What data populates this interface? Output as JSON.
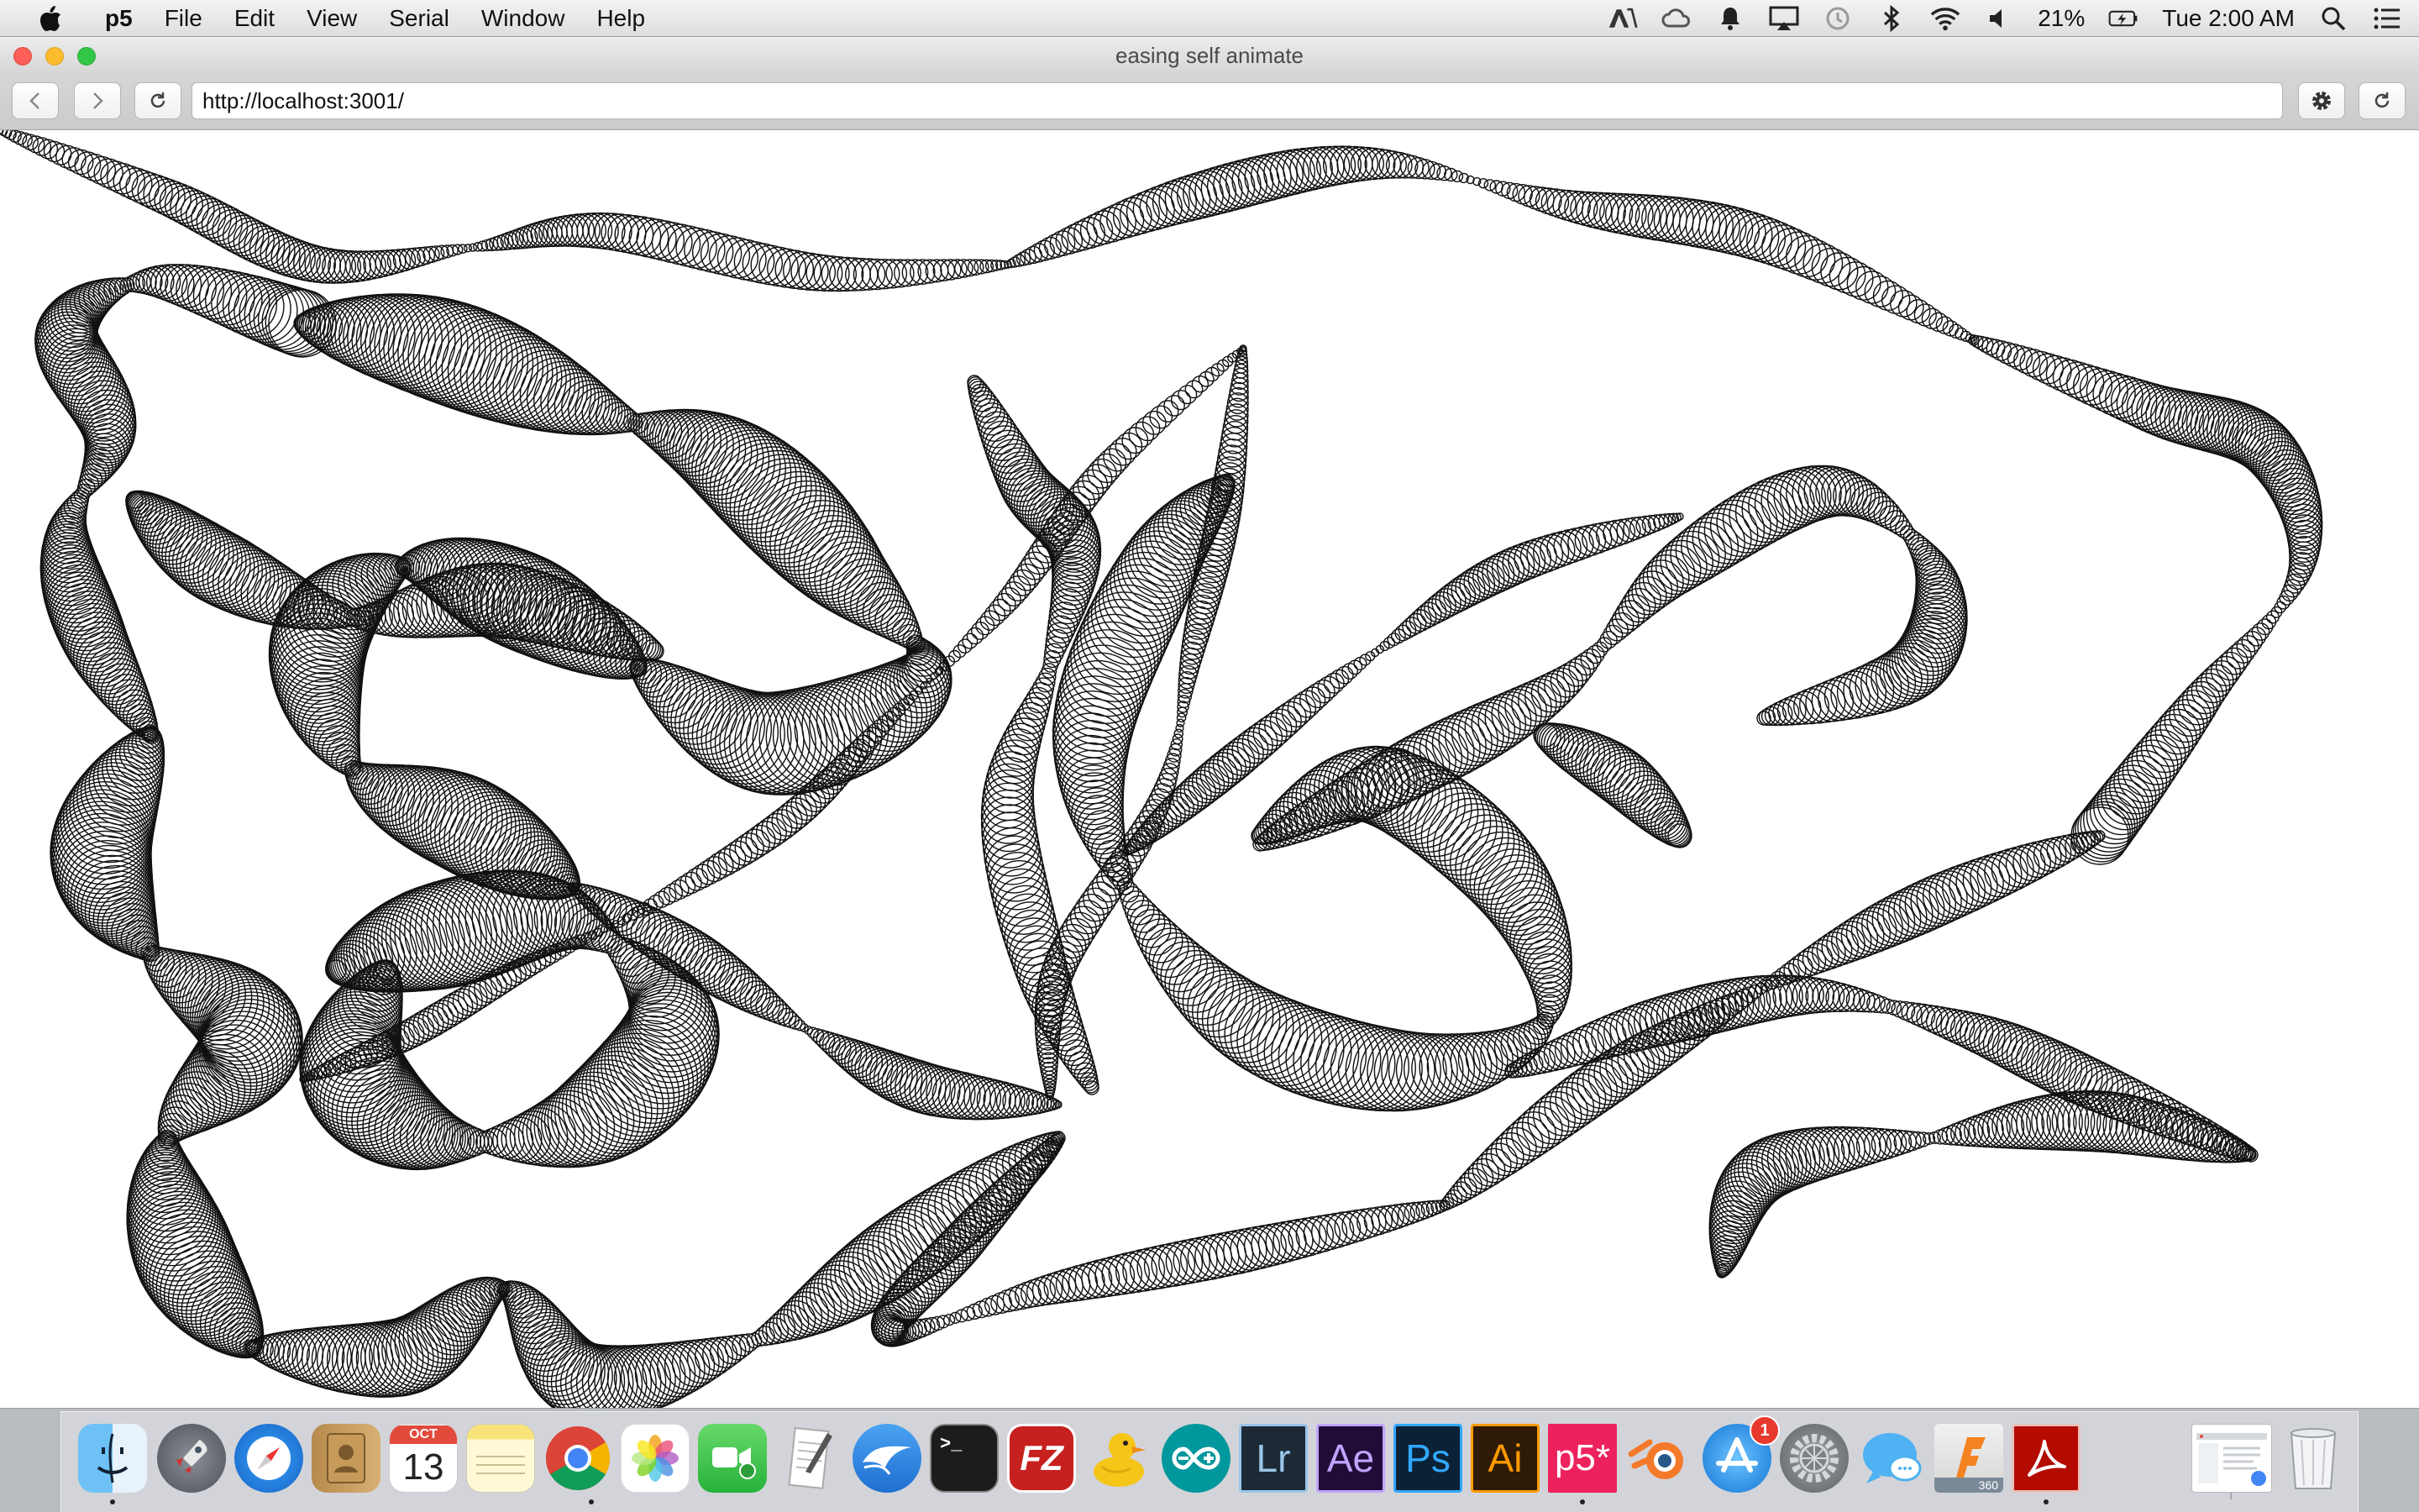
{
  "menubar": {
    "app_name": "p5",
    "items": [
      "File",
      "Edit",
      "View",
      "Serial",
      "Window",
      "Help"
    ],
    "status": {
      "battery_percent": "21%",
      "clock": "Tue 2:00 AM"
    }
  },
  "window": {
    "title": "easing self animate",
    "url": "http://localhost:3001/"
  },
  "dock": {
    "apps": [
      {
        "name": "Finder",
        "icon": "finder-icon",
        "running": true
      },
      {
        "name": "Launchpad",
        "icon": "launchpad-icon",
        "running": false
      },
      {
        "name": "Safari",
        "icon": "safari-icon",
        "running": false
      },
      {
        "name": "Contacts",
        "icon": "contacts-icon",
        "running": false
      },
      {
        "name": "Calendar",
        "icon": "calendar-icon",
        "running": false,
        "month": "OCT",
        "day": "13"
      },
      {
        "name": "Notes",
        "icon": "notes-icon",
        "running": false
      },
      {
        "name": "Chrome",
        "icon": "chrome-icon",
        "running": true
      },
      {
        "name": "Photos",
        "icon": "photos-icon",
        "running": false
      },
      {
        "name": "FaceTime",
        "icon": "facetime-icon",
        "running": false
      },
      {
        "name": "TextEdit",
        "icon": "textedit-icon",
        "running": false
      },
      {
        "name": "Mail",
        "icon": "mail-icon",
        "running": false
      },
      {
        "name": "Terminal",
        "icon": "terminal-icon",
        "running": false,
        "glyph": ">_"
      },
      {
        "name": "FileZilla",
        "icon": "filezilla-icon",
        "running": false,
        "glyph": "FZ"
      },
      {
        "name": "Cyberduck",
        "icon": "cyberduck-icon",
        "running": false
      },
      {
        "name": "Arduino",
        "icon": "arduino-icon",
        "running": false
      },
      {
        "name": "Lightroom",
        "icon": "lightroom-icon",
        "running": false,
        "glyph": "Lr"
      },
      {
        "name": "After Effects",
        "icon": "after-effects-icon",
        "running": false,
        "glyph": "Ae"
      },
      {
        "name": "Photoshop",
        "icon": "photoshop-icon",
        "running": false,
        "glyph": "Ps"
      },
      {
        "name": "Illustrator",
        "icon": "illustrator-icon",
        "running": false,
        "glyph": "Ai"
      },
      {
        "name": "p5",
        "icon": "p5-icon",
        "running": true,
        "glyph": "p5*"
      },
      {
        "name": "Blender",
        "icon": "blender-icon",
        "running": false
      },
      {
        "name": "App Store",
        "icon": "app-store-icon",
        "running": false,
        "badge": "1"
      },
      {
        "name": "System Preferences",
        "icon": "system-preferences-icon",
        "running": false
      },
      {
        "name": "Messages",
        "icon": "messages-icon",
        "running": false
      },
      {
        "name": "Fusion 360",
        "icon": "fusion-360-icon",
        "running": false,
        "glyph": "360"
      },
      {
        "name": "Acrobat",
        "icon": "acrobat-icon",
        "running": true
      }
    ],
    "extras": [
      {
        "name": "Downloads",
        "icon": "downloads-stack-icon"
      },
      {
        "name": "Trash",
        "icon": "trash-icon"
      }
    ]
  },
  "colors": {
    "chrome_blue": "#4285f4",
    "p5_pink": "#ed225d",
    "close": "#fc5f57",
    "minimize": "#fdbc2e",
    "maximize": "#33c748"
  }
}
